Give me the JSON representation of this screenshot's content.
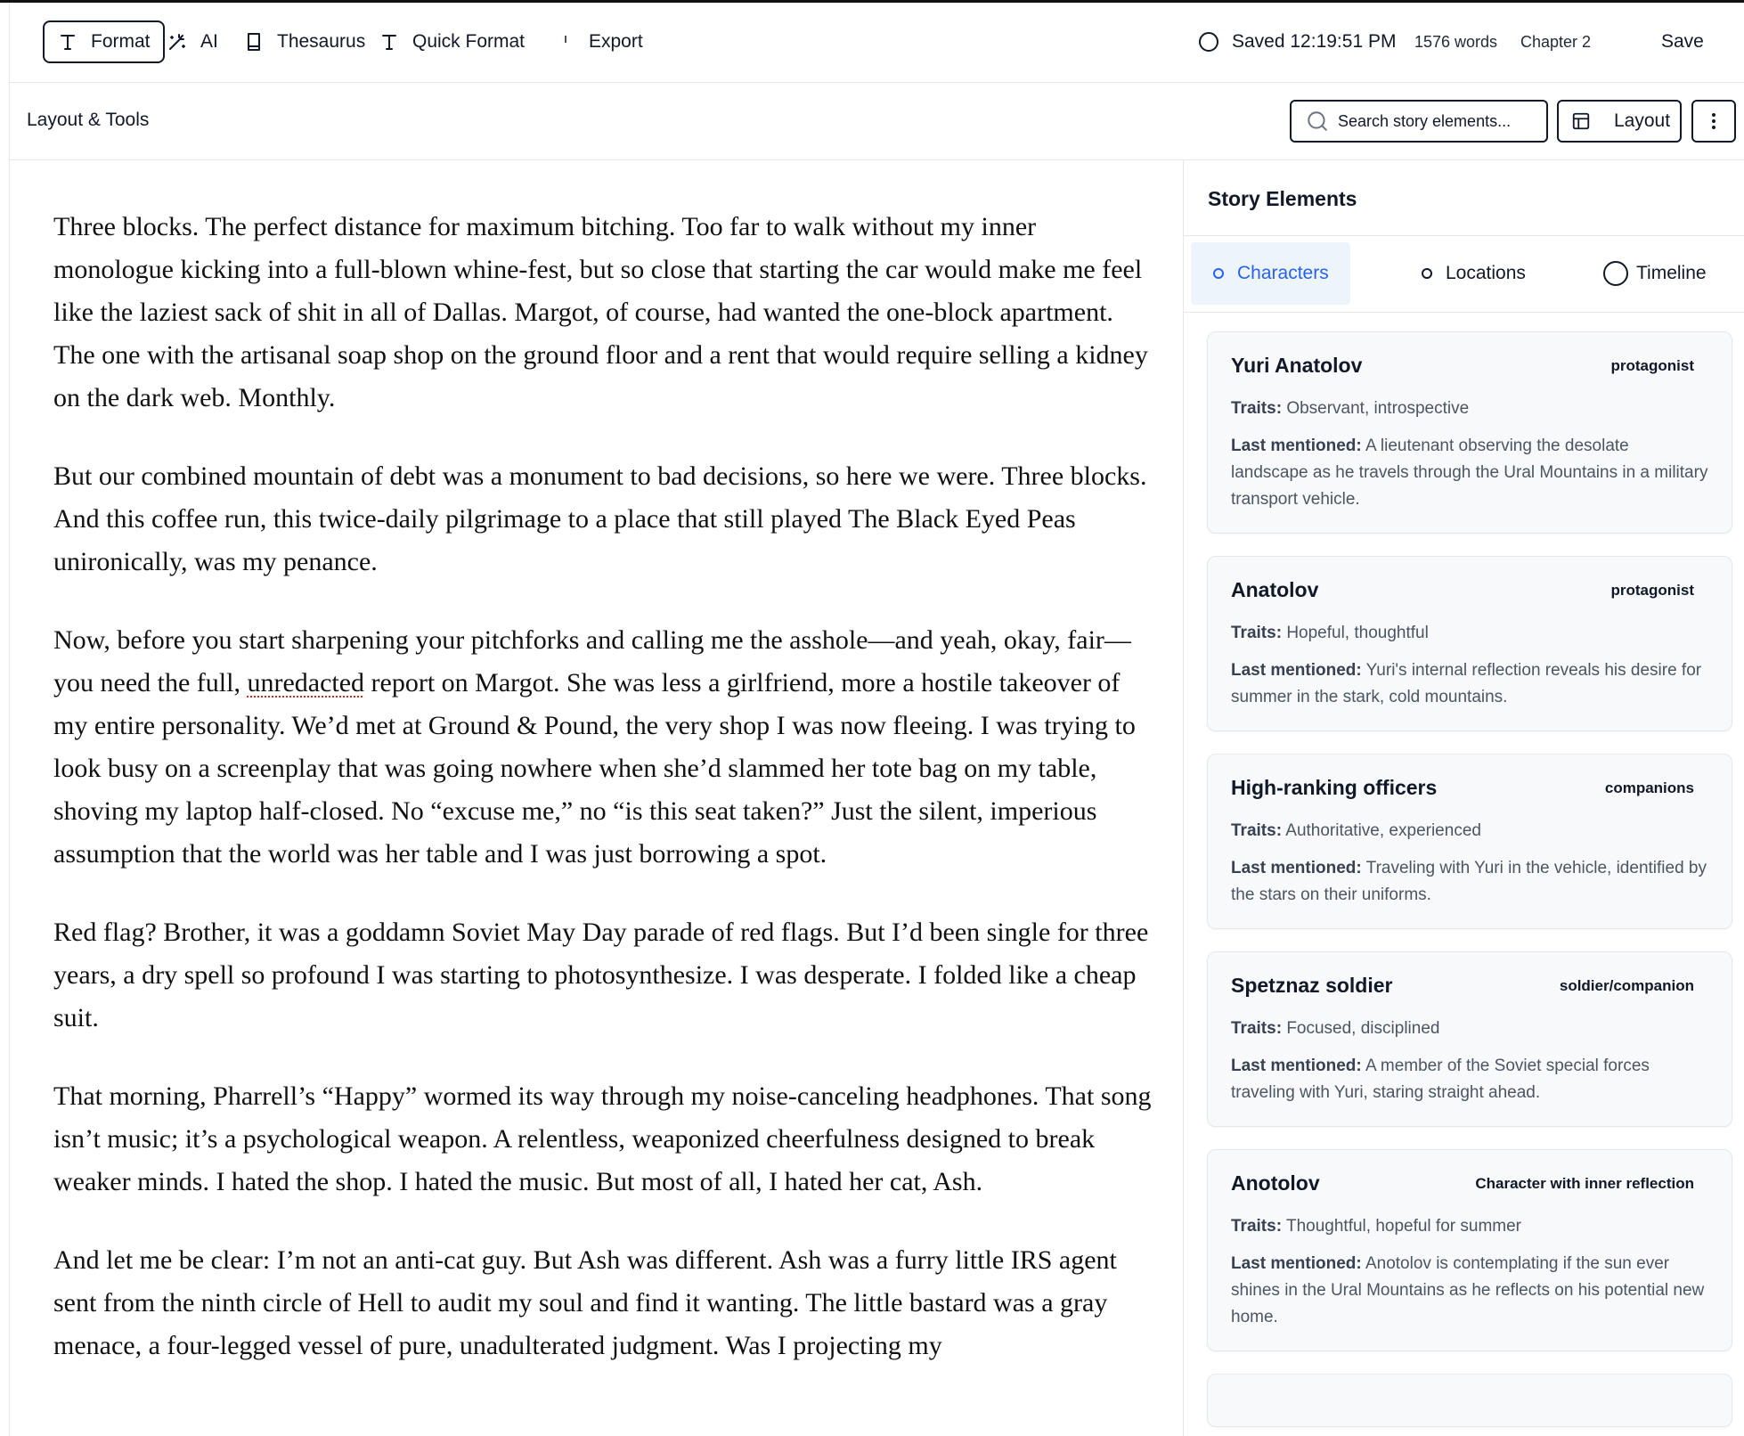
{
  "toolbar": {
    "format": "Format",
    "ai": "AI",
    "thesaurus": "Thesaurus",
    "quick_format": "Quick Format",
    "export": "Export",
    "saved": "Saved 12:19:51 PM",
    "word_count": "1576 words",
    "chapter": "Chapter 2",
    "save": "Save"
  },
  "subbar": {
    "title": "Layout & Tools",
    "search_placeholder": "Search story elements...",
    "layout": "Layout"
  },
  "editor": {
    "paragraphs": [
      "Three blocks. The perfect distance for maximum bitching. Too far to walk without my inner monologue kicking into a full-blown whine-fest, but so close that starting the car would make me feel like the laziest sack of shit in all of Dallas. Margot, of course, had wanted the one-block apartment. The one with the artisanal soap shop on the ground floor and a rent that would require selling a kidney on the dark web. Monthly.",
      "But our combined mountain of debt was a monument to bad decisions, so here we were. Three blocks. And this coffee run, this twice-daily pilgrimage to a place that still played The Black Eyed Peas unironically, was my penance.",
      {
        "before": "Now, before you start sharpening your pitchforks and calling me the asshole—and yeah, okay, fair—you need the full, ",
        "misspelled": "unredacted",
        "after": " report on Margot. She was less a girlfriend, more a hostile takeover of my entire personality. We’d met at Ground & Pound, the very shop I was now fleeing. I was trying to look busy on a screenplay that was going nowhere when she’d slammed her tote bag on my table, shoving my laptop half-closed. No “excuse me,” no “is this seat taken?” Just the silent, imperious assumption that the world was her table and I was just borrowing a spot."
      },
      "Red flag? Brother, it was a goddamn Soviet May Day parade of red flags. But I’d been single for three years, a dry spell so profound I was starting to photosynthesize. I was desperate. I folded like a cheap suit.",
      "That morning, Pharrell’s “Happy” wormed its way through my noise-canceling headphones. That song isn’t music; it’s a psychological weapon. A relentless, weaponized cheerfulness designed to break weaker minds. I hated the shop. I hated the music. But most of all, I hated her cat, Ash.",
      "And let me be clear: I’m not an anti-cat guy. But Ash was different. Ash was a furry little IRS agent sent from the ninth circle of Hell to audit my soul and find it wanting. The little bastard was a gray menace, a four-legged vessel of pure, unadulterated judgment. Was I projecting my"
    ]
  },
  "sidebar": {
    "title": "Story Elements",
    "tabs": {
      "characters": "Characters",
      "locations": "Locations",
      "timeline": "Timeline"
    },
    "traits_label": "Traits:",
    "last_label": "Last mentioned:",
    "characters": [
      {
        "name": "Yuri Anatolov",
        "role": "protagonist",
        "traits": "Observant, introspective",
        "last": "A lieutenant observing the desolate landscape as he travels through the Ural Mountains in a military transport vehicle."
      },
      {
        "name": "Anatolov",
        "role": "protagonist",
        "traits": "Hopeful, thoughtful",
        "last": "Yuri's internal reflection reveals his desire for summer in the stark, cold mountains."
      },
      {
        "name": "High-ranking officers",
        "role": "companions",
        "traits": "Authoritative, experienced",
        "last": "Traveling with Yuri in the vehicle, identified by the stars on their uniforms."
      },
      {
        "name": "Spetznaz soldier",
        "role": "soldier/companion",
        "traits": "Focused, disciplined",
        "last": "A member of the Soviet special forces traveling with Yuri, staring straight ahead."
      },
      {
        "name": "Anotolov",
        "role": "Character with inner reflection",
        "traits": "Thoughtful, hopeful for summer",
        "last": "Anotolov is contemplating if the sun ever shines in the Ural Mountains as he reflects on his potential new home."
      }
    ]
  },
  "colors": {
    "accent": "#2563eb",
    "active_tab_bg": "#eef4fc",
    "card_bg": "#f8f9fb",
    "border": "#e5e7eb"
  },
  "icons": [
    "type-icon",
    "wand-icon",
    "book-icon",
    "cursor-icon",
    "circle-icon",
    "search-icon",
    "layout-icon",
    "more-vertical-icon"
  ]
}
